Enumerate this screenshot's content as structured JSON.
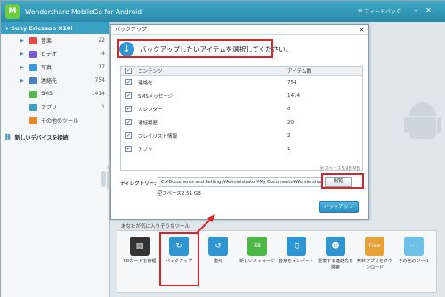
{
  "app": {
    "title": "Wondershare MobileGo for Android",
    "logo": "M",
    "feedback": "フィードバック"
  },
  "sidebar": {
    "device": "Sony Ericsson X10i",
    "items": [
      {
        "label": "音楽",
        "count": "22",
        "icon": "music-icon",
        "color": "#e34b4b",
        "expandable": true
      },
      {
        "label": "ビデオ",
        "count": "4",
        "icon": "video-icon",
        "color": "#7d5bd6",
        "expandable": true
      },
      {
        "label": "写真",
        "count": "17",
        "icon": "photo-icon",
        "color": "#3a9ad9",
        "expandable": true
      },
      {
        "label": "連絡先",
        "count": "754",
        "icon": "contacts-icon",
        "color": "#4a7fc0",
        "expandable": true
      },
      {
        "label": "SMS",
        "count": "1414",
        "icon": "sms-icon",
        "color": "#55b84a",
        "expandable": false
      },
      {
        "label": "アプリ",
        "count": "1",
        "icon": "apps-icon",
        "color": "#3aa0c4",
        "expandable": false
      },
      {
        "label": "その他のツール",
        "count": "",
        "icon": "tools-icon",
        "color": "#e58a2a",
        "expandable": false
      }
    ],
    "add_device": "新しいデバイスを接続"
  },
  "dialog": {
    "title": "バックアップ",
    "close": "×",
    "heading": "バックアップしたいアイテムを選択してください。",
    "table": {
      "col_content": "コンテンツ",
      "col_count": "アイテム数",
      "rows": [
        {
          "label": "連絡先",
          "count": "754"
        },
        {
          "label": "SMSメッセージ",
          "count": "1414"
        },
        {
          "label": "カレンダー",
          "count": "0"
        },
        {
          "label": "通話履歴",
          "count": "20"
        },
        {
          "label": "プレイリスト情報",
          "count": "2"
        },
        {
          "label": "アプリ",
          "count": "1"
        }
      ]
    },
    "total_space": "全スペース5.98 MB",
    "dir_label": "ディレクトリー:",
    "dir_value": "C:¥Documents and Settings¥Administrator¥My Documents¥Wondershare¥",
    "browse": "閲覧",
    "free_space": "空スペース2.51 GB",
    "backup_button": "バックアップ"
  },
  "tools": {
    "label": "あなたが気に入りそうなツール",
    "items": [
      {
        "label": "SDカードを管理",
        "icon": "sd-card-icon",
        "color": "#333333"
      },
      {
        "label": "バックアップ",
        "icon": "backup-icon",
        "color": "#2f95d1"
      },
      {
        "label": "復元",
        "icon": "restore-icon",
        "color": "#2f95d1"
      },
      {
        "label": "新しいメッセージ",
        "icon": "message-icon",
        "color": "#4db848"
      },
      {
        "label": "音楽をインポート",
        "icon": "music-import-icon",
        "color": "#2f95d1"
      },
      {
        "label": "重複する連絡先を検索",
        "icon": "duplicate-contacts-icon",
        "color": "#2f95d1"
      },
      {
        "label": "無料アプリをダウンロード",
        "icon": "free-apps-icon",
        "color": "#e8a23a"
      },
      {
        "label": "その他のツール",
        "icon": "more-tools-icon",
        "color": "#6ec0e6"
      }
    ]
  }
}
